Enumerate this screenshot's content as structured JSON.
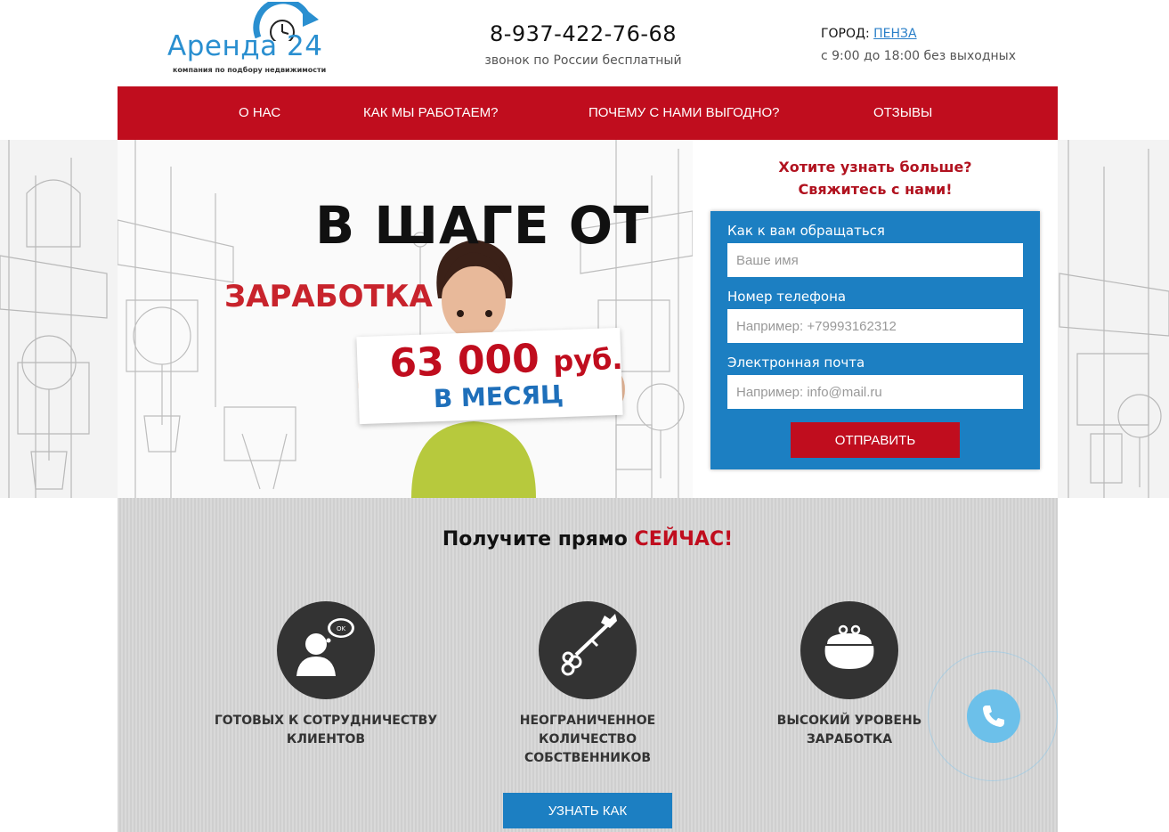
{
  "header": {
    "logo_text": "Аренда",
    "logo_number": "24",
    "logo_tagline": "компания по подбору недвижимости",
    "phone": "8-937-422-76-68",
    "phone_note": "звонок по России бесплатный",
    "city_label": "ГОРОД:",
    "city_value": "ПЕНЗА",
    "hours": "с 9:00 до 18:00 без выходных"
  },
  "nav": {
    "items": [
      {
        "label": "О НАС"
      },
      {
        "label": "КАК МЫ РАБОТАЕМ?"
      },
      {
        "label": "ПОЧЕМУ С НАМИ ВЫГОДНО?"
      },
      {
        "label": "ОТЗЫВЫ"
      }
    ]
  },
  "hero": {
    "title": "В ШАГЕ ОТ",
    "subtitle": "ЗАРАБОТКА",
    "amount": "63 000",
    "currency": "руб.",
    "period": "В МЕСЯЦ"
  },
  "contact": {
    "title_line1": "Хотите узнать больше?",
    "title_line2": "Свяжитесь с нами!",
    "name_label": "Как к вам обращаться",
    "name_placeholder": "Ваше имя",
    "phone_label": "Номер телефона",
    "phone_placeholder": "Например: +79993162312",
    "email_label": "Электронная почта",
    "email_placeholder": "Например: info@mail.ru",
    "submit_label": "ОТПРАВИТЬ"
  },
  "benefits": {
    "title_prefix": "Получите прямо",
    "title_accent": "СЕЙЧАС!",
    "items": [
      {
        "icon": "client-chat-icon",
        "line1": "ГОТОВЫХ К СОТРУДНИЧЕСТВУ",
        "line2": "КЛИЕНТОВ"
      },
      {
        "icon": "key-icon",
        "line1": "НЕОГРАНИЧЕННОЕ КОЛИЧЕСТВО",
        "line2": "СОБСТВЕННИКОВ"
      },
      {
        "icon": "purse-icon",
        "line1": "ВЫСОКИЙ УРОВЕНЬ ЗАРАБОТКА",
        "line2": ""
      }
    ],
    "button_label": "УЗНАТЬ КАК",
    "bubble_text": "OK"
  },
  "colors": {
    "brand_red": "#c00d1e",
    "brand_blue": "#1c7fc2",
    "logo_blue": "#2a8fd0",
    "dark_circle": "#333333"
  }
}
